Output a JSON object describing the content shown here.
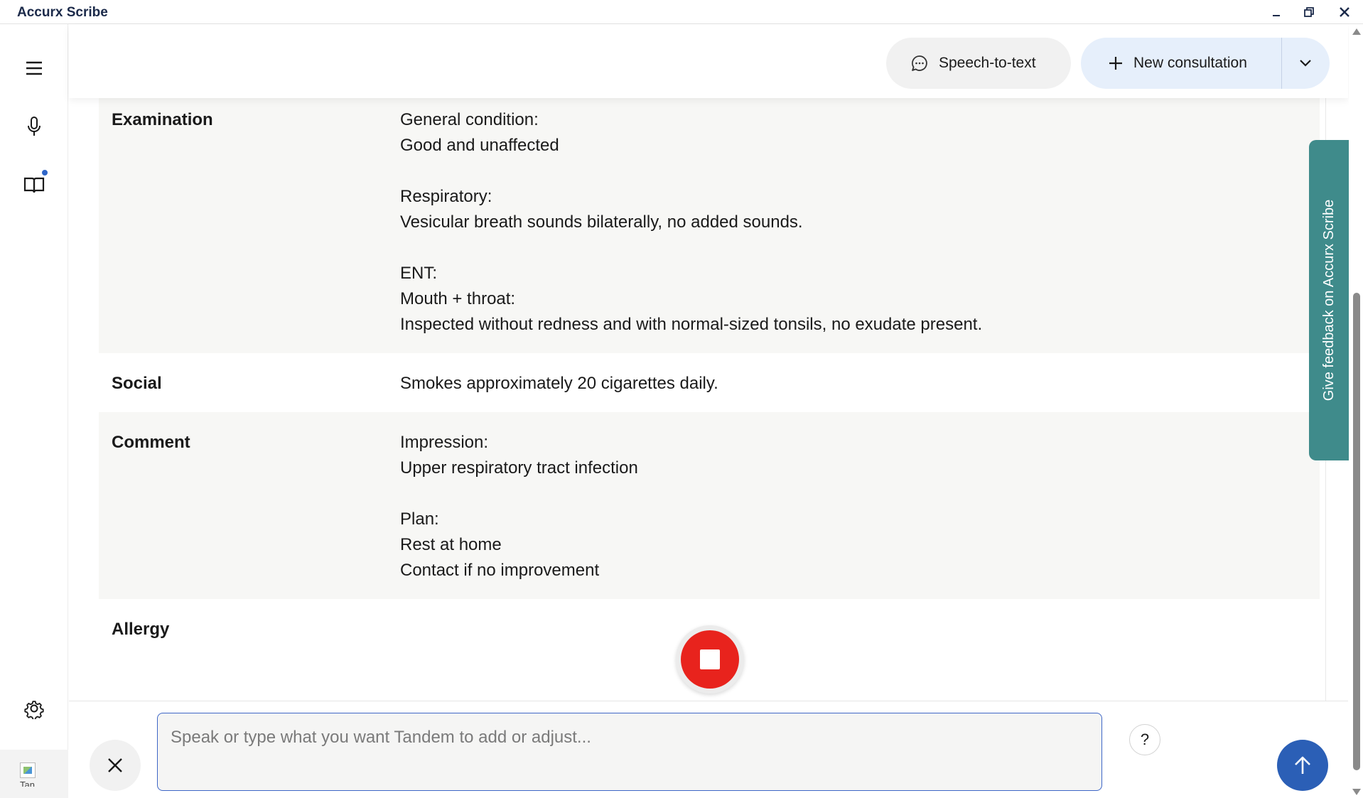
{
  "window": {
    "title": "Accurx Scribe"
  },
  "header": {
    "speech_to_text_label": "Speech-to-text",
    "new_consultation_label": "New consultation"
  },
  "sections": [
    {
      "label": "Examination",
      "shaded": true,
      "lines": [
        "General condition:",
        "Good and unaffected",
        "",
        "Respiratory:",
        "Vesicular breath sounds bilaterally, no added sounds.",
        "",
        "ENT:",
        "Mouth + throat:",
        "Inspected without redness and with normal-sized tonsils, no exudate present."
      ]
    },
    {
      "label": "Social",
      "shaded": false,
      "lines": [
        "Smokes approximately 20 cigarettes daily."
      ]
    },
    {
      "label": "Comment",
      "shaded": true,
      "lines": [
        "Impression:",
        "Upper respiratory tract infection",
        "",
        "Plan:",
        "Rest at home",
        "Contact if no improvement"
      ]
    },
    {
      "label": "Allergy",
      "shaded": false,
      "lines": []
    }
  ],
  "feedback": {
    "label": "Give feedback on Accurx Scribe"
  },
  "prompt": {
    "placeholder": "Speak or type what you want Tandem to add or adjust...",
    "value": "",
    "help_label": "?"
  },
  "user": {
    "avatar_alt": "Tan"
  },
  "colors": {
    "accent_blue": "#2b5fb6",
    "record_red": "#e8231d",
    "feedback_teal": "#3f8b8b",
    "new_consultation_bg": "#e6effb"
  },
  "icons": {
    "menu": "hamburger-icon",
    "mic": "microphone-icon",
    "book": "book-icon",
    "settings": "gear-icon",
    "speech": "chat-bubble-icon",
    "add": "plus-icon",
    "dropdown": "chevron-down-icon",
    "close": "close-icon",
    "send": "arrow-up-icon",
    "stop": "stop-icon"
  }
}
